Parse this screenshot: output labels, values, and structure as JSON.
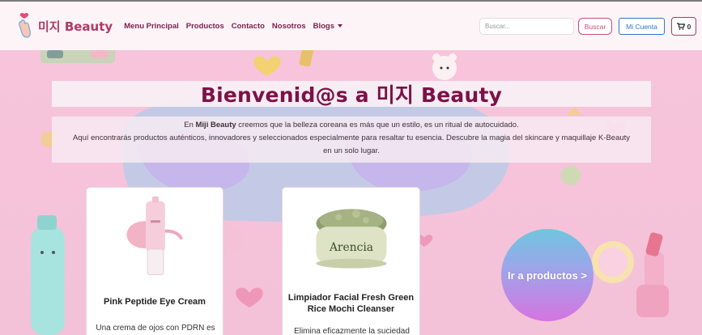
{
  "navbar": {
    "brand_text": "미지 Beauty",
    "logo_icon": "finger-heart-icon",
    "links": [
      {
        "label": "Menu Principal"
      },
      {
        "label": "Productos"
      },
      {
        "label": "Contacto"
      },
      {
        "label": "Nosotros"
      },
      {
        "label": "Blogs"
      }
    ],
    "search": {
      "placeholder": "Buscar...",
      "value": ""
    },
    "search_button": "Buscar",
    "account_button": "Mi Cuenta",
    "cart_count": "0",
    "cart_icon": "shopping-cart-icon"
  },
  "hero": {
    "title": "Bienvenid@s a 미지 Beauty",
    "line1_pre": "En ",
    "line1_bold": "Miji Beauty",
    "line1_post": " creemos que la belleza coreana es más que un estilo, es un ritual de autocuidado.",
    "line2": "Aquí encontrarás productos auténticos, innovadores y seleccionados especialmente para resaltar tu esencia. Descubre la magia del skincare y maquillaje K-Beauty",
    "line3": "en un solo lugar."
  },
  "products": [
    {
      "name": "Pink Peptide Eye Cream",
      "description": "Una crema de ojos con PDRN es"
    },
    {
      "name": "Limpiador Facial Fresh Green Rice Mochi Cleanser",
      "description": "Elimina eficazmente la suciedad"
    }
  ],
  "cta": {
    "label": "Ir a productos >"
  },
  "colors": {
    "brand": "#b03a63",
    "title": "#7d1147",
    "account": "#2d78c8"
  }
}
